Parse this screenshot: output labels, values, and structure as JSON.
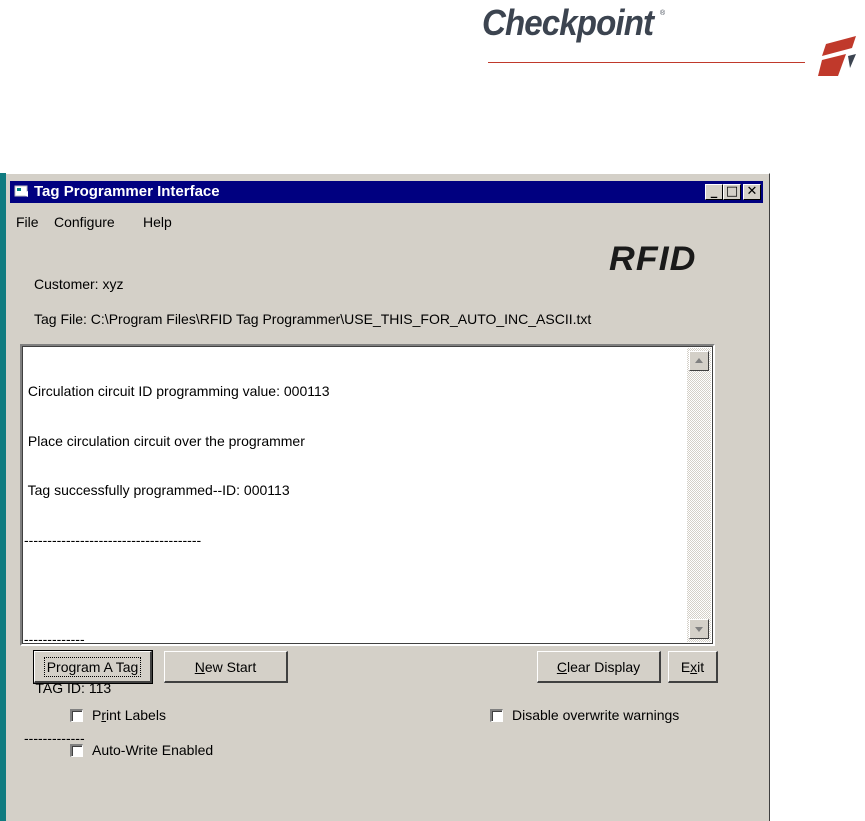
{
  "brand": {
    "name": "Checkpoint",
    "registered_mark": "®"
  },
  "window": {
    "title": "Tag Programmer Interface",
    "controls": {
      "minimize": "_",
      "maximize": "□",
      "close": "✕"
    }
  },
  "menu": {
    "file": "File",
    "configure": "Configure",
    "help": "Help"
  },
  "logo_text": "RFID",
  "customer_label": "Customer: xyz",
  "tag_file_label": "Tag File: C:\\Program Files\\RFID Tag Programmer\\USE_THIS_FOR_AUTO_INC_ASCII.txt",
  "display": {
    "lines": [
      " Circulation circuit ID programming value: 000113",
      " Place circulation circuit over the programmer",
      " Tag successfully programmed--ID: 000113",
      "--------------------------------------",
      "",
      "-------------",
      "   TAG ID: 113",
      "-------------"
    ]
  },
  "buttons": {
    "program_pre": "Program A Ta",
    "program_u": "g",
    "new_start_u": "N",
    "new_start_rest": "ew Start",
    "clear_u": "C",
    "clear_rest": "lear Display",
    "exit_pre": "E",
    "exit_u": "x",
    "exit_rest": "it"
  },
  "checkboxes": {
    "print_pre": "P",
    "print_u": "r",
    "print_rest": "int Labels",
    "auto_write": "Auto-Write Enabled",
    "disable_overwrite": "Disable overwrite warnings"
  },
  "colors": {
    "titlebar": "#000080",
    "window_face": "#d4d0c8",
    "brand_red": "#c0392b",
    "desktop_teal": "#0f7b80"
  }
}
